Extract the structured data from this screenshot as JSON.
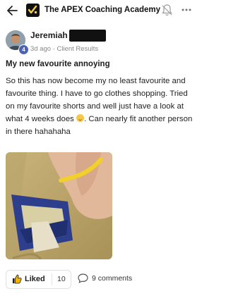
{
  "header": {
    "app_title": "The APEX Coaching Academy",
    "icons": [
      "back-arrow-icon",
      "apex-logo-icon",
      "bell-off-icon",
      "more-icon"
    ]
  },
  "post": {
    "author": "Jeremiah",
    "level": "4",
    "meta": "3d ago · Client Results",
    "title": "My new favourite annoying",
    "body": "So this has now become my no least favourite and favourite thing. I have to go clothes shopping. Tried on my favourite shorts and well just have a look at what 4 weeks does",
    "body_after_emoji": ". Can nearly fit another person in there hahahaha"
  },
  "actions": {
    "like_label": "Liked",
    "like_count": "10",
    "comments_label": "9 comments"
  },
  "colors": {
    "accent_logo": "#111111",
    "badge": "#4a63b5",
    "text": "#1c1c1c",
    "meta": "#888888"
  }
}
